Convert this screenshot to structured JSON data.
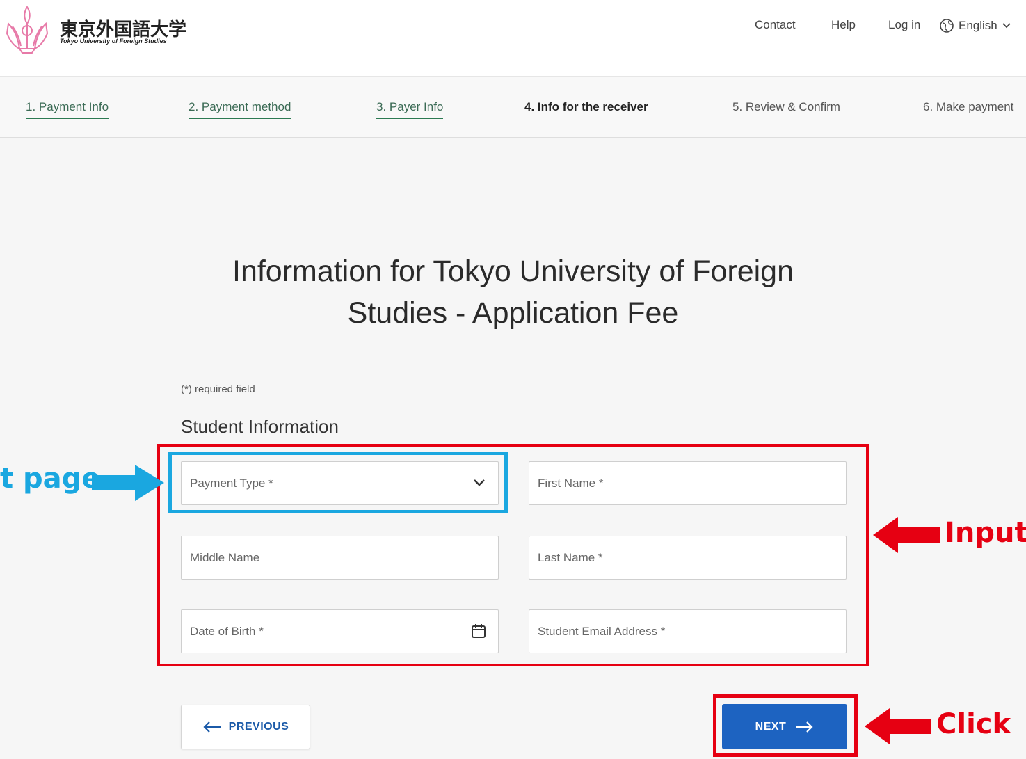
{
  "header": {
    "brand_ja": "東京外国語大学",
    "brand_en": "Tokyo University of Foreign Studies",
    "nav": {
      "contact": "Contact",
      "help": "Help",
      "login": "Log in"
    },
    "language": {
      "label": "English",
      "icon": "globe-icon",
      "chevron": "chevron-down-icon"
    }
  },
  "stepper": {
    "steps": [
      {
        "label": "1. Payment Info",
        "state": "done"
      },
      {
        "label": "2. Payment method",
        "state": "done"
      },
      {
        "label": "3. Payer Info",
        "state": "done"
      },
      {
        "label": "4. Info for the receiver",
        "state": "current"
      },
      {
        "label": "5. Review & Confirm",
        "state": "pending"
      },
      {
        "label": "6. Make payment",
        "state": "pending"
      }
    ]
  },
  "main": {
    "title_line1": "Information for Tokyo University of Foreign",
    "title_line2": "Studies - Application Fee",
    "required_note": "(*) required field",
    "section_title": "Student Information",
    "fields": {
      "payment_type": {
        "placeholder": "Payment Type *",
        "icon": "chevron-down-icon"
      },
      "first_name": {
        "placeholder": "First Name *"
      },
      "middle_name": {
        "placeholder": "Middle Name"
      },
      "last_name": {
        "placeholder": "Last Name *"
      },
      "date_of_birth": {
        "placeholder": "Date of Birth *",
        "icon": "calendar-icon"
      },
      "email": {
        "placeholder": "Student Email Address *"
      }
    },
    "buttons": {
      "previous": "PREVIOUS",
      "next": "NEXT"
    }
  },
  "annotations": {
    "blue_label": "t page",
    "input_label": "Input",
    "click_label": "Click",
    "colors": {
      "red": "#e60012",
      "blue": "#1aa7e0",
      "primary": "#1d63c1",
      "step_done": "#2c7a52"
    }
  }
}
